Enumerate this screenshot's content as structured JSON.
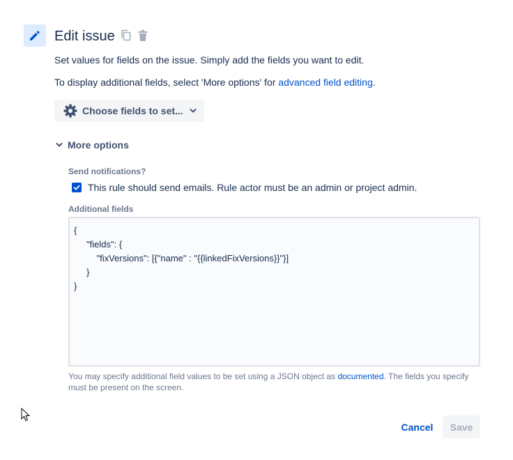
{
  "header": {
    "title": "Edit issue",
    "icons": [
      "pencil-icon",
      "copy-icon",
      "trash-icon"
    ]
  },
  "description": {
    "line1": "Set values for fields on the issue. Simply add the fields you want to edit.",
    "line2_prefix": "To display additional fields, select 'More options' for ",
    "line2_link": "advanced field editing",
    "line2_suffix": "."
  },
  "choose_fields": {
    "label": "Choose fields to set...",
    "icon": "gear-icon"
  },
  "more_options": {
    "label": "More options",
    "expanded": true
  },
  "notifications": {
    "label": "Send notifications?",
    "checkbox_label": "This rule should send emails. Rule actor must be an admin or project admin.",
    "checked": true
  },
  "additional_fields": {
    "label": "Additional fields",
    "lines": [
      "{",
      "     \"fields\": {",
      "         \"fixVersions\": [{\"name\" : \"{{linkedFixVersions}}\"}]",
      "     }",
      "}"
    ],
    "help_prefix": "You may specify additional field values to be set using a JSON object as ",
    "help_link": "documented",
    "help_suffix": ". The fields you specify must be present on the screen."
  },
  "footer": {
    "cancel_label": "Cancel",
    "save_label": "Save"
  },
  "colors": {
    "accent": "#0052cc",
    "icon_bg": "#deebff",
    "button_bg": "#f4f5f7",
    "text": "#172b4d",
    "muted": "#6b778c"
  }
}
